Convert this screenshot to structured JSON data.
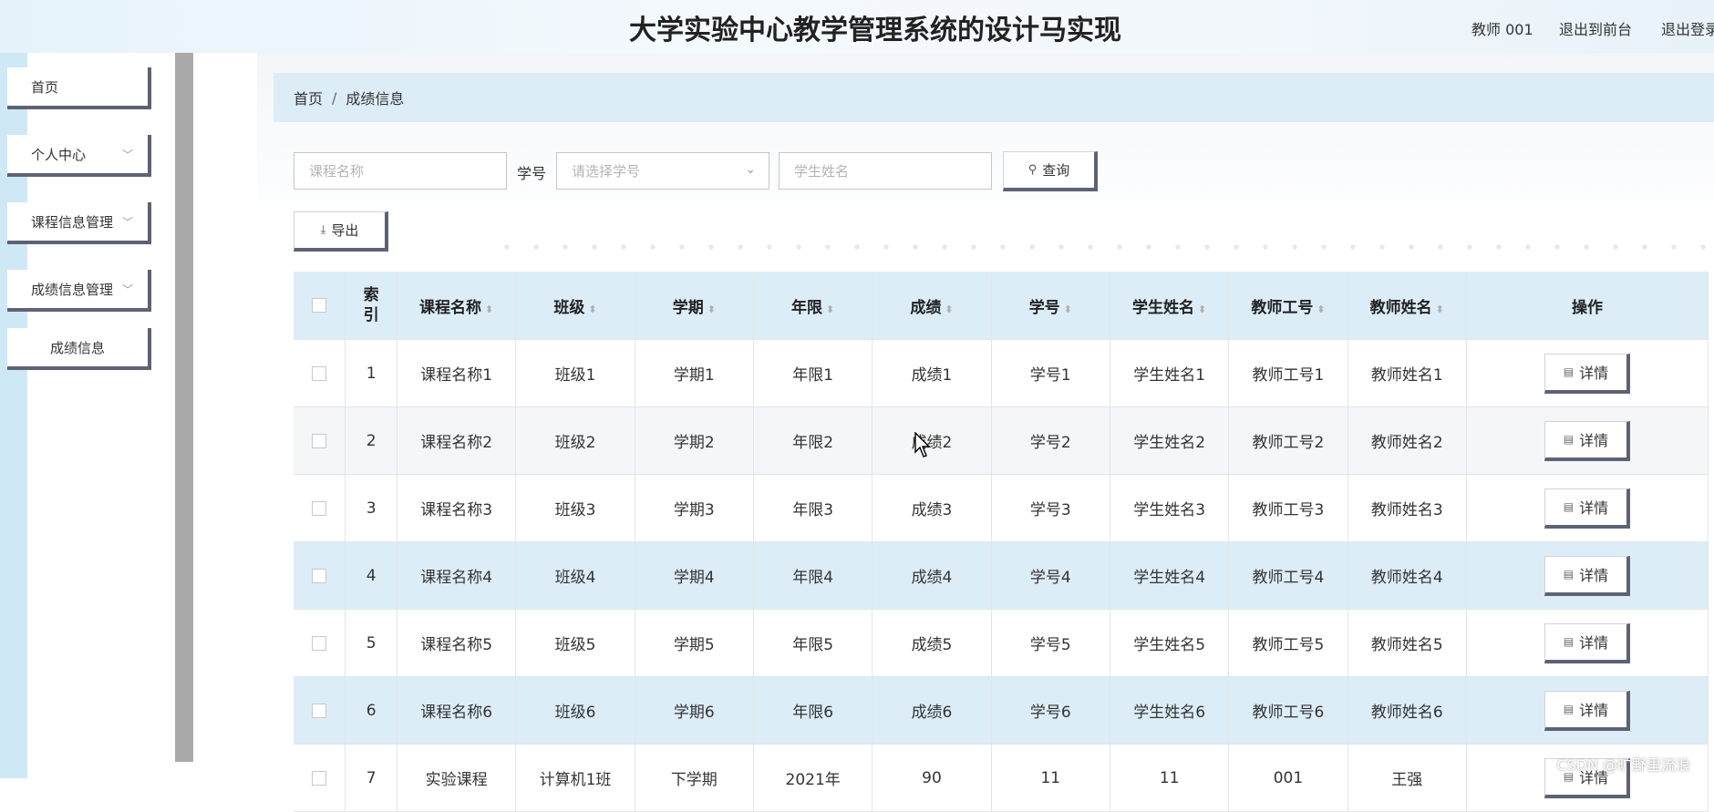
{
  "header": {
    "title": "大学实验中心教学管理系统的设计马实现",
    "user": "教师 001",
    "back_front": "退出到前台",
    "logout": "退出登录"
  },
  "sidebar": {
    "items": [
      {
        "label": "首页"
      },
      {
        "label": "个人中心"
      },
      {
        "label": "课程信息管理"
      },
      {
        "label": "成绩信息管理"
      }
    ],
    "sub_item": "成绩信息"
  },
  "breadcrumb": {
    "home": "首页",
    "sep": "/",
    "current": "成绩信息"
  },
  "search": {
    "course_placeholder": "课程名称",
    "student_id_label": "学号",
    "student_id_placeholder": "请选择学号",
    "student_name_placeholder": "学生姓名",
    "query_label": "查询"
  },
  "toolbar": {
    "export_label": "导出"
  },
  "table": {
    "headers": [
      "索引",
      "课程名称",
      "班级",
      "学期",
      "年限",
      "成绩",
      "学号",
      "学生姓名",
      "教师工号",
      "教师姓名",
      "操作"
    ],
    "detail_label": "详情",
    "rows": [
      [
        "1",
        "课程名称1",
        "班级1",
        "学期1",
        "年限1",
        "成绩1",
        "学号1",
        "学生姓名1",
        "教师工号1",
        "教师姓名1"
      ],
      [
        "2",
        "课程名称2",
        "班级2",
        "学期2",
        "年限2",
        "成绩2",
        "学号2",
        "学生姓名2",
        "教师工号2",
        "教师姓名2"
      ],
      [
        "3",
        "课程名称3",
        "班级3",
        "学期3",
        "年限3",
        "成绩3",
        "学号3",
        "学生姓名3",
        "教师工号3",
        "教师姓名3"
      ],
      [
        "4",
        "课程名称4",
        "班级4",
        "学期4",
        "年限4",
        "成绩4",
        "学号4",
        "学生姓名4",
        "教师工号4",
        "教师姓名4"
      ],
      [
        "5",
        "课程名称5",
        "班级5",
        "学期5",
        "年限5",
        "成绩5",
        "学号5",
        "学生姓名5",
        "教师工号5",
        "教师姓名5"
      ],
      [
        "6",
        "课程名称6",
        "班级6",
        "学期6",
        "年限6",
        "成绩6",
        "学号6",
        "学生姓名6",
        "教师工号6",
        "教师姓名6"
      ],
      [
        "7",
        "实验课程",
        "计算机1班",
        "下学期",
        "2021年",
        "90",
        "11",
        "11",
        "001",
        "王强"
      ]
    ]
  },
  "watermark": "CSDN @旷野里流浪"
}
